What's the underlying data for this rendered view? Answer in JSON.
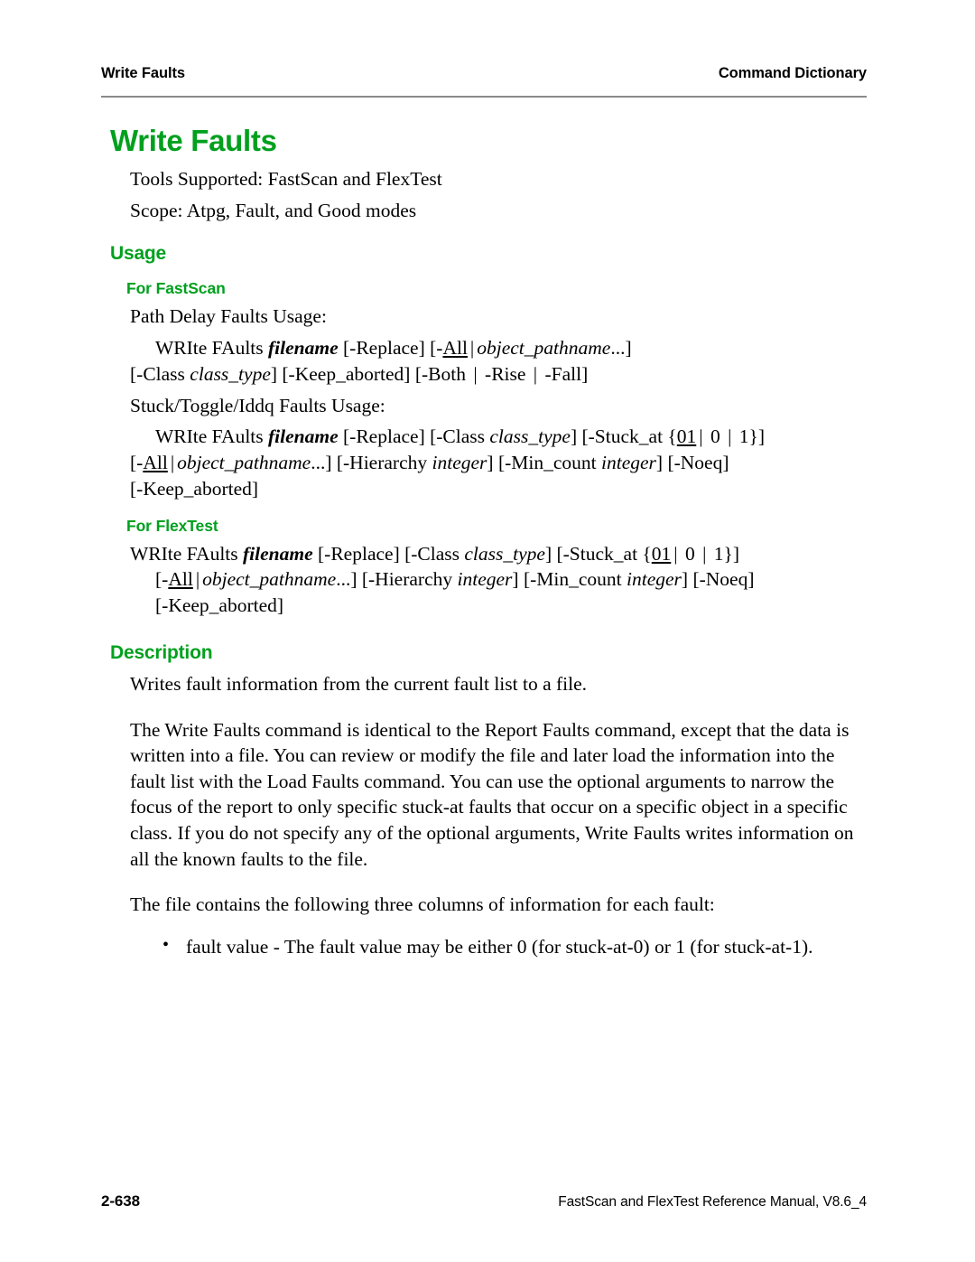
{
  "header": {
    "left": "Write Faults",
    "right": "Command Dictionary"
  },
  "title": "Write Faults",
  "intro": {
    "tools_supported": "Tools Supported: FastScan and FlexTest",
    "scope": "Scope: Atpg, Fault, and Good modes"
  },
  "usage": {
    "heading": "Usage",
    "fastscan": {
      "heading": "For FastScan",
      "path_delay_label": "Path Delay Faults Usage:",
      "path_delay_syntax": {
        "line1_pre": "WRIte FAults ",
        "line1_filename": "filename",
        "line1_mid": " [-Replace] [-",
        "line1_all": "All",
        "line1_bar": "|",
        "line1_obj": "object_pathname",
        "line1_post": "...]",
        "line2_pre": "[-Class ",
        "line2_class": "class_type",
        "line2_post": "] [-Keep_aborted] [-Both ",
        "line2_bar1": "|",
        "line2_rise": " -Rise ",
        "line2_bar2": "|",
        "line2_fall": " -Fall]"
      },
      "stuck_label": "Stuck/Toggle/Iddq Faults Usage:",
      "stuck_syntax": {
        "line1_pre": "WRIte FAults ",
        "line1_filename": "filename",
        "line1_mid": " [-Replace] [-Class ",
        "line1_class": "class_type",
        "line1_mid2": "] [-Stuck_at {",
        "line1_01": "01",
        "line1_bar1": "|",
        "line1_zero": " 0 ",
        "line1_bar2": "|",
        "line1_one": " 1}]",
        "line2_pre": "[-",
        "line2_all": "All",
        "line2_bar": "|",
        "line2_obj": "object_pathname",
        "line2_mid": "...] [-Hierarchy ",
        "line2_int1": "integer",
        "line2_mid2": "] [-Min_count ",
        "line2_int2": "integer",
        "line2_post": "] [-Noeq]",
        "line3": "[-Keep_aborted]"
      }
    },
    "flextest": {
      "heading": "For FlexTest",
      "syntax": {
        "line1_pre": "WRIte FAults ",
        "line1_filename": "filename",
        "line1_mid": " [-Replace] [-Class ",
        "line1_class": "class_type",
        "line1_mid2": "] [-Stuck_at {",
        "line1_01": "01",
        "line1_bar1": "|",
        "line1_zero": " 0 ",
        "line1_bar2": "|",
        "line1_one": " 1}]",
        "line2_pre": "[-",
        "line2_all": "All",
        "line2_bar": "|",
        "line2_obj": "object_pathname",
        "line2_mid": "...] [-Hierarchy ",
        "line2_int1": "integer",
        "line2_mid2": "] [-Min_count ",
        "line2_int2": "integer",
        "line2_post": "] [-Noeq]",
        "line3": "[-Keep_aborted]"
      }
    }
  },
  "description": {
    "heading": "Description",
    "para1": "Writes fault information from the current fault list to a file.",
    "para2": "The Write Faults command is identical to the Report Faults command, except that the data is written into a file. You can review or modify the file and later load the information into the fault list with the Load Faults command. You can use the optional arguments to narrow the focus of the report to only specific stuck-at faults that occur on a specific object in a specific class. If you do not specify any of the optional arguments, Write Faults writes information on all the known faults to the file.",
    "para3": "The file contains the following three columns of information for each fault:",
    "bullets": [
      "fault value - The fault value may be either 0 (for stuck-at-0) or 1 (for stuck-at-1)."
    ]
  },
  "footer": {
    "page_number": "2-638",
    "manual": "FastScan and FlexTest Reference Manual, V8.6_4"
  },
  "colors": {
    "heading_green": "#00A01E",
    "rule_gray": "#8a8a8a",
    "text_black": "#000000"
  }
}
